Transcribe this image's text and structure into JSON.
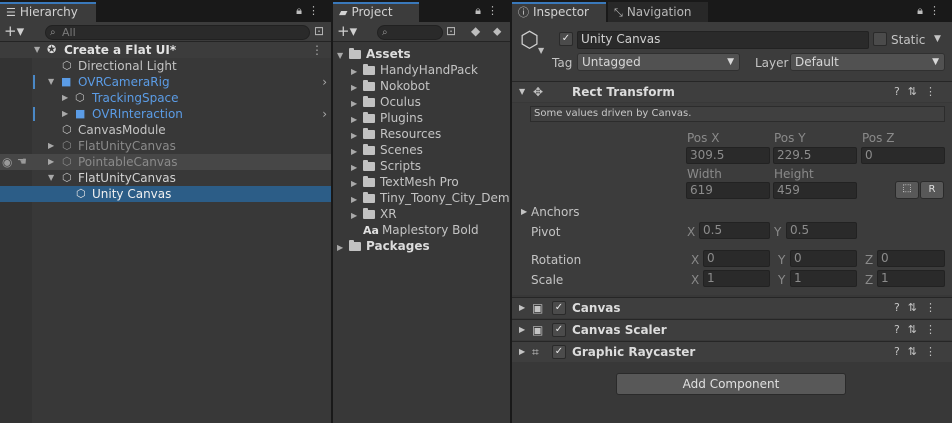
{
  "hierarchy": {
    "tab_label": "Hierarchy",
    "search_placeholder": "All",
    "scene_name": "Create a Flat UI*",
    "items": [
      {
        "label": "Directional Light"
      },
      {
        "label": "OVRCameraRig"
      },
      {
        "label": "TrackingSpace"
      },
      {
        "label": "OVRInteraction"
      },
      {
        "label": "CanvasModule"
      },
      {
        "label": "FlatUnityCanvas"
      },
      {
        "label": "PointableCanvas"
      },
      {
        "label": "FlatUnityCanvas"
      },
      {
        "label": "Unity Canvas"
      }
    ]
  },
  "project": {
    "tab_label": "Project",
    "root": "Assets",
    "folders": [
      "HandyHandPack",
      "Nokobot",
      "Oculus",
      "Plugins",
      "Resources",
      "Scenes",
      "Scripts",
      "TextMesh Pro",
      "Tiny_Toony_City_Demo",
      "XR"
    ],
    "font_asset_prefix": "Aa",
    "font_asset": "Maplestory Bold",
    "packages": "Packages"
  },
  "inspector": {
    "tab_label": "Inspector",
    "nav_tab_label": "Navigation",
    "object_name": "Unity Canvas",
    "static_label": "Static",
    "tag_label": "Tag",
    "tag_value": "Untagged",
    "layer_label": "Layer",
    "layer_value": "Default",
    "rect_transform": {
      "title": "Rect Transform",
      "note": "Some values driven by Canvas.",
      "pos_x_label": "Pos X",
      "pos_x": "309.5",
      "pos_y_label": "Pos Y",
      "pos_y": "229.5",
      "pos_z_label": "Pos Z",
      "pos_z": "0",
      "width_label": "Width",
      "width": "619",
      "height_label": "Height",
      "height": "459",
      "r_button": "R",
      "anchors_label": "Anchors",
      "pivot_label": "Pivot",
      "pivot_x": "0.5",
      "pivot_y": "0.5",
      "rotation_label": "Rotation",
      "rot_x": "0",
      "rot_y": "0",
      "rot_z": "0",
      "scale_label": "Scale",
      "scale_x": "1",
      "scale_y": "1",
      "scale_z": "1",
      "x": "X",
      "y": "Y",
      "z": "Z"
    },
    "components": [
      "Canvas",
      "Canvas Scaler",
      "Graphic Raycaster"
    ],
    "add_component": "Add Component"
  }
}
